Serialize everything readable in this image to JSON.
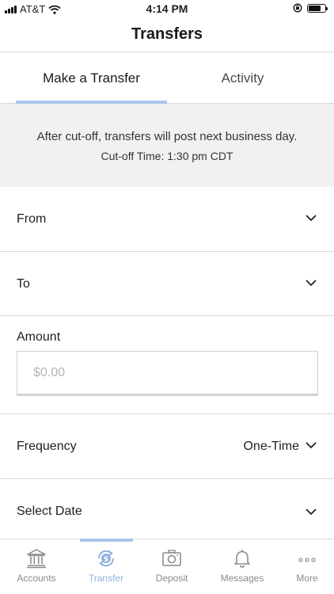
{
  "status_bar": {
    "carrier": "AT&T",
    "time": "4:14 PM"
  },
  "header": {
    "title": "Transfers"
  },
  "tabs": [
    {
      "label": "Make a Transfer",
      "selected": true
    },
    {
      "label": "Activity",
      "selected": false
    }
  ],
  "notice": {
    "line1": "After cut-off, transfers will post next business day.",
    "line2": "Cut-off Time: 1:30 pm CDT"
  },
  "form": {
    "from_label": "From",
    "to_label": "To",
    "amount_label": "Amount",
    "amount_placeholder": "$0.00",
    "frequency_label": "Frequency",
    "frequency_value": "One-Time",
    "date_label": "Select Date"
  },
  "bottom_nav": {
    "items": [
      {
        "label": "Accounts",
        "icon": "bank-icon"
      },
      {
        "label": "Transfer",
        "icon": "transfer-dollar-icon",
        "active": true
      },
      {
        "label": "Deposit",
        "icon": "camera-icon"
      },
      {
        "label": "Messages",
        "icon": "bell-icon"
      },
      {
        "label": "More",
        "icon": "more-dots-icon"
      }
    ]
  },
  "colors": {
    "accent": "#a9c6ec",
    "active_nav": "#8fb2e0",
    "banner_bg": "#f1f1f1",
    "divider": "#d9d9d9"
  }
}
